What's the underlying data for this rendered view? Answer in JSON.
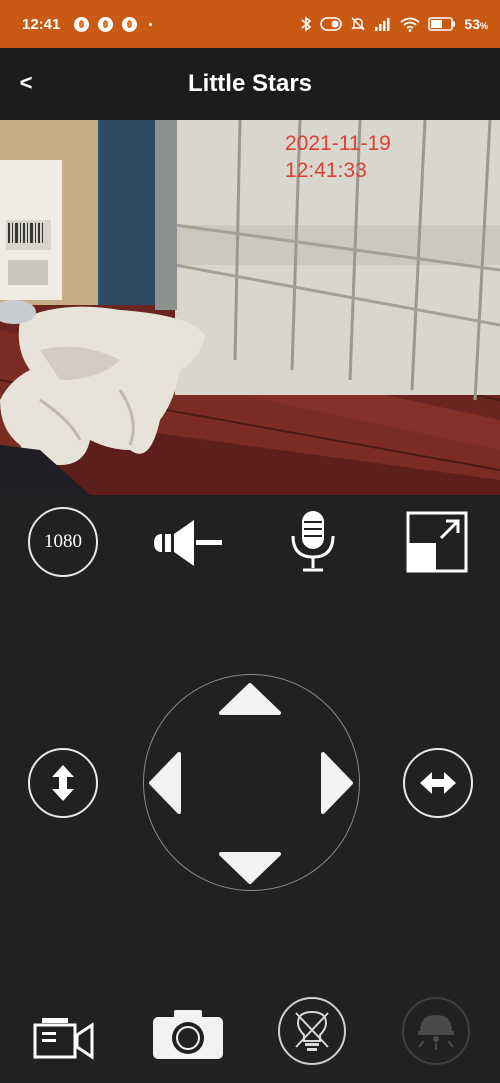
{
  "status_bar": {
    "time": "12:41",
    "battery_percent": "53",
    "percent_sign": "%",
    "icons": [
      "flame-notification-icon",
      "flame-notification-icon",
      "flame-notification-icon",
      "bluetooth-icon",
      "toggle-icon",
      "mute-icon",
      "signal-icon",
      "wifi-icon",
      "battery-icon"
    ]
  },
  "header": {
    "back_label": "<",
    "title": "Little Stars"
  },
  "video": {
    "date": "2021-11-19",
    "time": "12:41:33"
  },
  "toolbar": {
    "resolution_label": "1080",
    "icons": [
      "speaker-icon",
      "microphone-icon",
      "fullscreen-icon"
    ]
  },
  "ptz": {
    "icons": [
      "vertical-flip-icon",
      "arrow-up-icon",
      "arrow-left-icon",
      "arrow-right-icon",
      "arrow-down-icon",
      "horizontal-flip-icon"
    ]
  },
  "bottom_bar": {
    "icons": [
      "record-video-icon",
      "camera-snapshot-icon",
      "light-off-icon",
      "night-light-icon"
    ]
  },
  "colors": {
    "status_bar": "#c85a14",
    "background": "#212121",
    "timestamp": "#d9413a"
  }
}
